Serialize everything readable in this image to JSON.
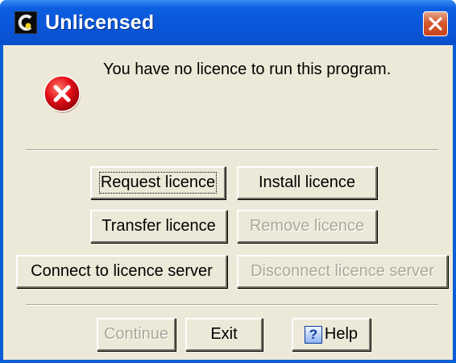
{
  "window": {
    "title": "Unlicensed"
  },
  "icons": {
    "app": "app-logo-icon",
    "close": "close-icon",
    "error": "error-icon",
    "help": "help-icon"
  },
  "message": "You have no licence to run this program.",
  "buttons": {
    "request_licence": "Request licence",
    "install_licence": "Install licence",
    "transfer_licence": "Transfer licence",
    "remove_licence": "Remove licence",
    "connect_server": "Connect to licence server",
    "disconnect_server": "Disconnect licence server",
    "continue": "Continue",
    "exit": "Exit",
    "help": "Help",
    "help_glyph": "?"
  },
  "states": {
    "focused": "request_licence",
    "disabled": [
      "remove_licence",
      "disconnect_server",
      "continue"
    ]
  },
  "colors": {
    "titlebar": "#0a55d8",
    "dialog_bg": "#ece9d8",
    "close_button": "#d55a2e",
    "error_red": "#e3101a",
    "disabled_text": "#aca899"
  }
}
